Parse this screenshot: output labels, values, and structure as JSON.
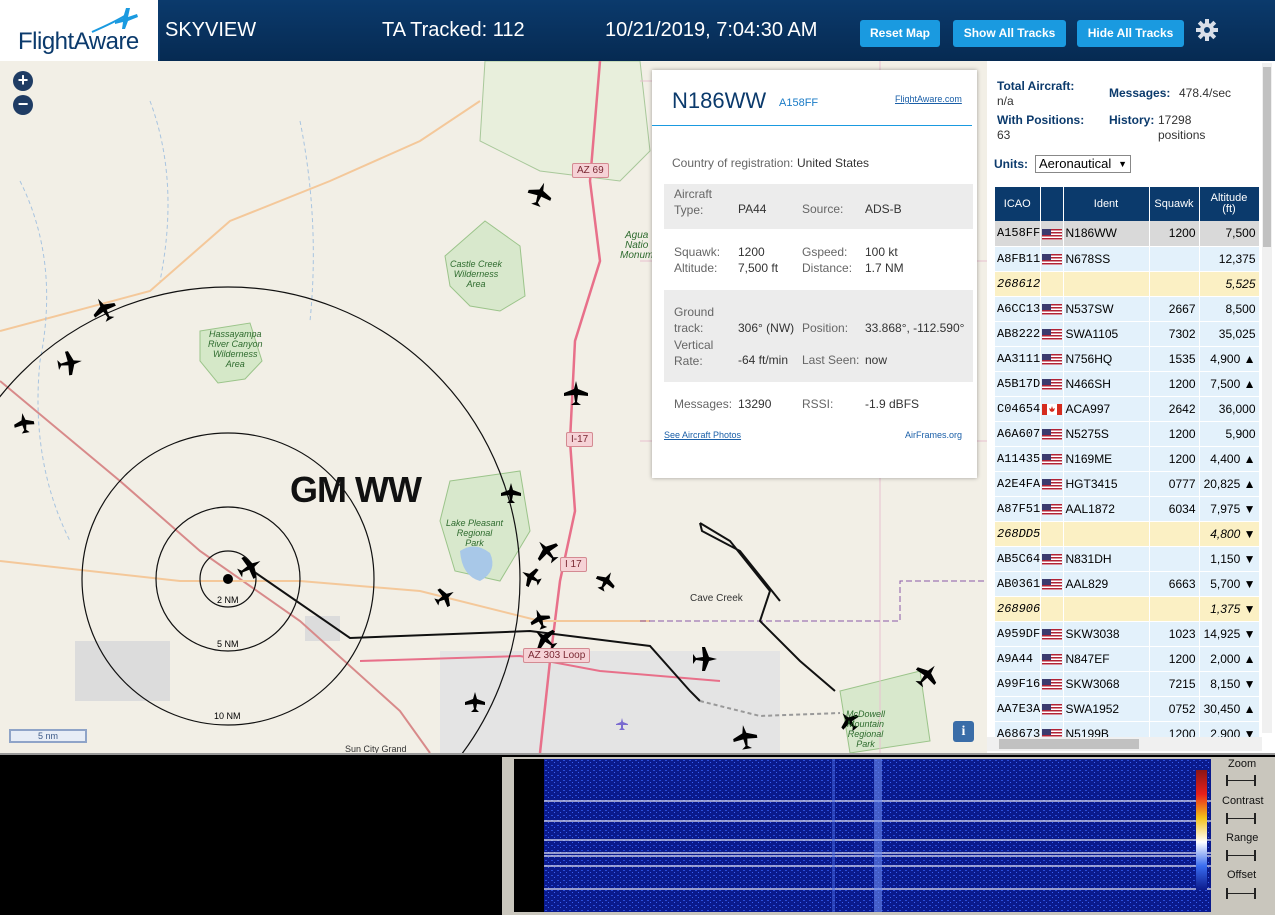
{
  "header": {
    "logo_text": "FlightAware",
    "app_name": "SKYVIEW",
    "ta_tracked": "TA Tracked: 112",
    "datetime": "10/21/2019, 7:04:30 AM",
    "reset_map": "Reset Map",
    "show_all": "Show All Tracks",
    "hide_all": "Hide All Tracks"
  },
  "map": {
    "zoom_in": "+",
    "zoom_out": "−",
    "scale": "5 nm",
    "big_label": "GM WW",
    "rings": [
      "2 NM",
      "5 NM",
      "10 NM"
    ],
    "places": {
      "castle_creek": "Castle Creek\nWilderness\nArea",
      "hassayampa": "Hassayampa\nRiver Canyon\nWilderness\nArea",
      "lake_pleasant": "Lake Pleasant\nRegional\nPark",
      "agua": "Agua\nNatio\nMonum",
      "cave_creek": "Cave Creek",
      "mcdowell": "McDowell\nMountain\nRegional\nPark",
      "sun_city": "Sun City Grand"
    },
    "highways": [
      "AZ 69",
      "I-17",
      "I 17",
      "AZ 303 Loop"
    ],
    "info": "i"
  },
  "popup": {
    "title": "N186WW",
    "icao": "A158FF",
    "fa_link": "FlightAware.com",
    "country_label": "Country of registration:",
    "country": "United States",
    "aircraft_type_label": "Aircraft\nType:",
    "aircraft_type": "PA44",
    "source_label": "Source:",
    "source": "ADS-B",
    "squawk_label": "Squawk:",
    "squawk": "1200",
    "altitude_label": "Altitude:",
    "altitude": "7,500 ft",
    "gspeed_label": "Gspeed:",
    "gspeed": "100 kt",
    "distance_label": "Distance:",
    "distance": "1.7 NM",
    "ground_track_label": "Ground\ntrack:",
    "ground_track": "306° (NW)",
    "position_label": "Position:",
    "position": "33.868°, -112.590°",
    "vrate_label": "Vertical\nRate:",
    "vrate": "-64 ft/min",
    "last_seen_label": "Last Seen:",
    "last_seen": "now",
    "messages_label": "Messages:",
    "messages": "13290",
    "rssi_label": "RSSI:",
    "rssi": "-1.9 dBFS",
    "photos_link": "See Aircraft Photos",
    "airframes_link": "AirFrames.org"
  },
  "panel": {
    "total_aircraft_label": "Total Aircraft:",
    "total_aircraft": "n/a",
    "messages_label": "Messages:",
    "messages": "478.4/sec",
    "with_positions_label": "With Positions:",
    "with_positions": "63",
    "history_label": "History:",
    "history": "17298\npositions",
    "units_label": "Units:",
    "units_value": "Aeronautical",
    "columns": [
      "ICAO",
      "",
      "Ident",
      "Squawk",
      "Altitude\n(ft)"
    ],
    "rows": [
      {
        "icao": "A158FF",
        "flag": "us",
        "ident": "N186WW",
        "squawk": "1200",
        "alt": "7,500",
        "kind": "sel"
      },
      {
        "icao": "A8FB11",
        "flag": "us",
        "ident": "N678SS",
        "squawk": "",
        "alt": "12,375",
        "kind": ""
      },
      {
        "icao": "268612",
        "flag": "",
        "ident": "",
        "squawk": "",
        "alt": "5,525",
        "kind": "noid"
      },
      {
        "icao": "A6CC13",
        "flag": "us",
        "ident": "N537SW",
        "squawk": "2667",
        "alt": "8,500",
        "kind": ""
      },
      {
        "icao": "AB8222",
        "flag": "us",
        "ident": "SWA1105",
        "squawk": "7302",
        "alt": "35,025",
        "kind": ""
      },
      {
        "icao": "AA3111",
        "flag": "us",
        "ident": "N756HQ",
        "squawk": "1535",
        "alt": "4,900 ▲",
        "kind": ""
      },
      {
        "icao": "A5B17D",
        "flag": "us",
        "ident": "N466SH",
        "squawk": "1200",
        "alt": "7,500 ▲",
        "kind": ""
      },
      {
        "icao": "C04654",
        "flag": "ca",
        "ident": "ACA997",
        "squawk": "2642",
        "alt": "36,000",
        "kind": ""
      },
      {
        "icao": "A6A607",
        "flag": "us",
        "ident": "N5275S",
        "squawk": "1200",
        "alt": "5,900",
        "kind": ""
      },
      {
        "icao": "A11435",
        "flag": "us",
        "ident": "N169ME",
        "squawk": "1200",
        "alt": "4,400 ▲",
        "kind": ""
      },
      {
        "icao": "A2E4FA",
        "flag": "us",
        "ident": "HGT3415",
        "squawk": "0777",
        "alt": "20,825 ▲",
        "kind": ""
      },
      {
        "icao": "A87F51",
        "flag": "us",
        "ident": "AAL1872",
        "squawk": "6034",
        "alt": "7,975 ▼",
        "kind": ""
      },
      {
        "icao": "268DD5",
        "flag": "",
        "ident": "",
        "squawk": "",
        "alt": "4,800 ▼",
        "kind": "noid"
      },
      {
        "icao": "AB5C64",
        "flag": "us",
        "ident": "N831DH",
        "squawk": "",
        "alt": "1,150 ▼",
        "kind": ""
      },
      {
        "icao": "AB0361",
        "flag": "us",
        "ident": "AAL829",
        "squawk": "6663",
        "alt": "5,700 ▼",
        "kind": ""
      },
      {
        "icao": "268906",
        "flag": "",
        "ident": "",
        "squawk": "",
        "alt": "1,375 ▼",
        "kind": "noid"
      },
      {
        "icao": "A959DF",
        "flag": "us",
        "ident": "SKW3038",
        "squawk": "1023",
        "alt": "14,925 ▼",
        "kind": ""
      },
      {
        "icao": "A9A44",
        "flag": "us",
        "ident": "N847EF",
        "squawk": "1200",
        "alt": "2,000 ▲",
        "kind": ""
      },
      {
        "icao": "A99F16",
        "flag": "us",
        "ident": "SKW3068",
        "squawk": "7215",
        "alt": "8,150 ▼",
        "kind": ""
      },
      {
        "icao": "AA7E3A",
        "flag": "us",
        "ident": "SWA1952",
        "squawk": "0752",
        "alt": "30,450 ▲",
        "kind": ""
      },
      {
        "icao": "A68673",
        "flag": "us",
        "ident": "N5199B",
        "squawk": "1200",
        "alt": "2,900 ▼",
        "kind": ""
      }
    ]
  },
  "waterfall": {
    "zoom": "Zoom",
    "contrast": "Contrast",
    "range": "Range",
    "offset": "Offset"
  },
  "colors": {
    "header_bg": "#0b3a6c",
    "button": "#1a9ae0",
    "table_row": "#e3f1fb",
    "table_noid": "#fbf0c4"
  }
}
